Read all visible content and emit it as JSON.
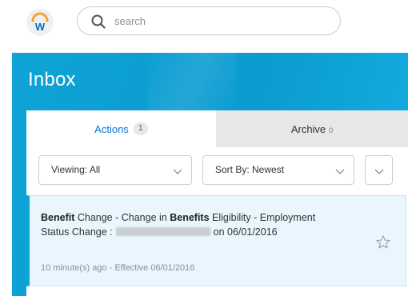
{
  "header": {
    "logo_letter": "W",
    "search": {
      "placeholder": "search",
      "value": ""
    }
  },
  "inbox": {
    "title": "Inbox",
    "tabs": [
      {
        "label": "Actions",
        "count": "1",
        "active": true
      },
      {
        "label": "Archive",
        "count": "0",
        "active": false
      }
    ],
    "viewing_label": "Viewing: All",
    "sort_label": "Sort By: Newest",
    "items": [
      {
        "title_bold_1": "Benefit",
        "title_text_1": " Change - Change in ",
        "title_bold_2": "Benefits",
        "title_text_2": " Eligibility - Employment Status Change :",
        "title_text_3": "on 06/01/2016",
        "meta": "10 minute(s) ago - Effective 06/01/2016",
        "starred": false
      }
    ]
  },
  "colors": {
    "accent_blue": "#0875e1",
    "hero_blue": "#0fa3d6",
    "item_highlight": "#e9f6fd",
    "logo_orange": "#f5a623",
    "logo_blue": "#0a6fc2"
  },
  "icons": {
    "search": "search-icon",
    "chevron": "chevron-down-icon",
    "star": "star-outline-icon"
  }
}
